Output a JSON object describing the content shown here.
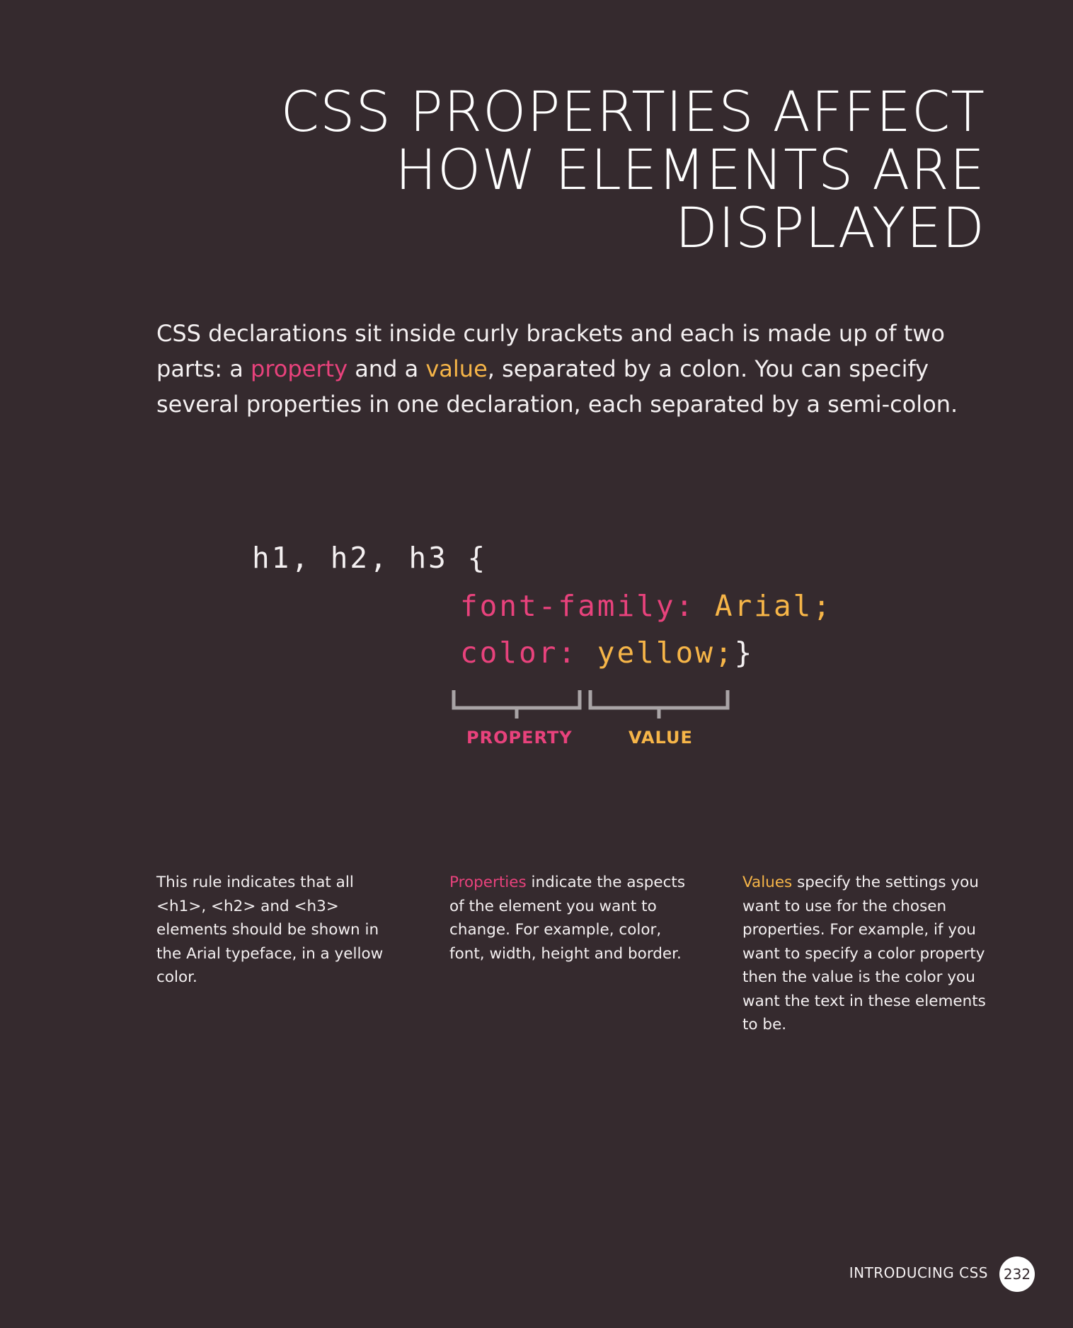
{
  "heading": {
    "line1": "CSS PROPERTIES AFFECT",
    "line2": "HOW ELEMENTS ARE",
    "line3": "DISPLAYED"
  },
  "intro": {
    "part1": "CSS declarations sit inside curly brackets and each is made up of two parts: a ",
    "property_word": "property",
    "part2": " and a ",
    "value_word": "value",
    "part3": ", separated by a colon. You can specify several properties in one declaration, each separated by a semi-colon."
  },
  "code": {
    "selector": "h1, h2, h3 {",
    "line1_property": "font-family:",
    "line1_value": " Arial;",
    "line2_property": "color:",
    "line2_value": " yellow;",
    "closing_brace": "}"
  },
  "diagram": {
    "property_label": "PROPERTY",
    "value_label": "VALUE"
  },
  "columns": {
    "col1": {
      "text": "This rule indicates that all <h1>, <h2> and <h3> elements should be shown in the Arial typeface, in a yellow color."
    },
    "col2": {
      "highlight": "Properties",
      "text": " indicate the aspects of the element you want to change. For example, color, font, width, height and border."
    },
    "col3": {
      "highlight": "Values",
      "text": " specify the settings you want to use for the chosen properties. For example, if you want to specify a color property then the value is the color you want the text in these elements to be."
    }
  },
  "footer": {
    "section": "INTRODUCING CSS",
    "page_number": "232"
  },
  "colors": {
    "background": "#352a2e",
    "property": "#e8427c",
    "value": "#f6b548",
    "text": "#f4f0f1",
    "bracket": "#a9a4a6"
  }
}
